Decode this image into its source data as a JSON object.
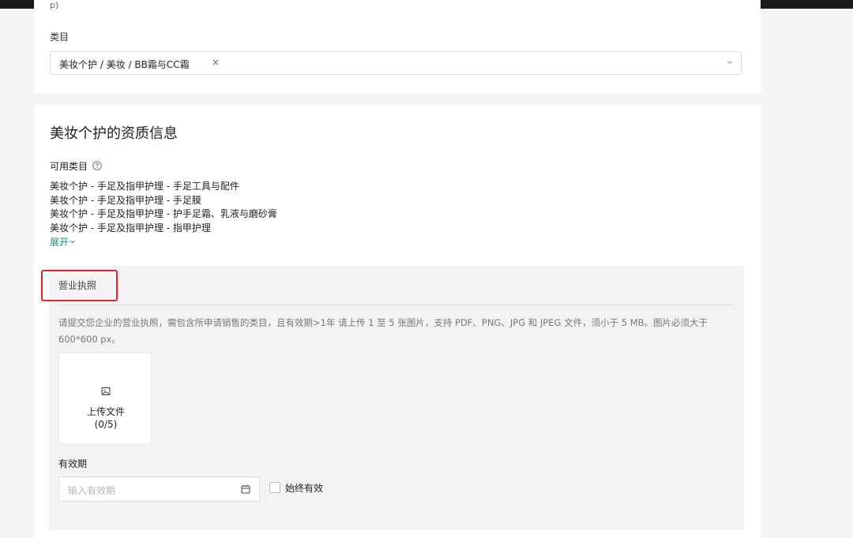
{
  "top_card": {
    "partial_text": "p)",
    "category_label": "类目",
    "selected_category": "美妆个护 / 美妆 / BB霜与CC霜",
    "remove_glyph": "×"
  },
  "qualification": {
    "title": "美妆个护的资质信息",
    "available_label": "可用类目",
    "categories": [
      "美妆个护 - 手足及指甲护理 - 手足工具与配件",
      "美妆个护 - 手足及指甲护理 - 手足膜",
      "美妆个护 - 手足及指甲护理 - 护手足霜、乳液与磨砂膏",
      "美妆个护 - 手足及指甲护理 - 指甲护理"
    ],
    "expand_label": "展开",
    "license": {
      "tab_label": "营业执照",
      "instructions": "请提交您企业的营业执照，需包含所申请销售的类目，且有效期>1年 请上传 1 至 5 张图片，支持 PDF、PNG、JPG 和 JPEG 文件，须小于 5 MB。图片必须大于 600*600 px。",
      "upload_label": "上传文件",
      "upload_count": "(0/5)",
      "validity_label": "有效期",
      "date_placeholder": "输入有效期",
      "always_valid_label": "始终有效"
    }
  },
  "colors": {
    "link": "#1a8e8a",
    "highlight_box": "#e0242b",
    "panel_bg": "#f3f3f3",
    "page_bg": "#f5f5f6"
  },
  "icons": [
    "help-circle-icon",
    "chevron-down-icon",
    "image-upload-icon",
    "calendar-icon",
    "close-icon"
  ]
}
